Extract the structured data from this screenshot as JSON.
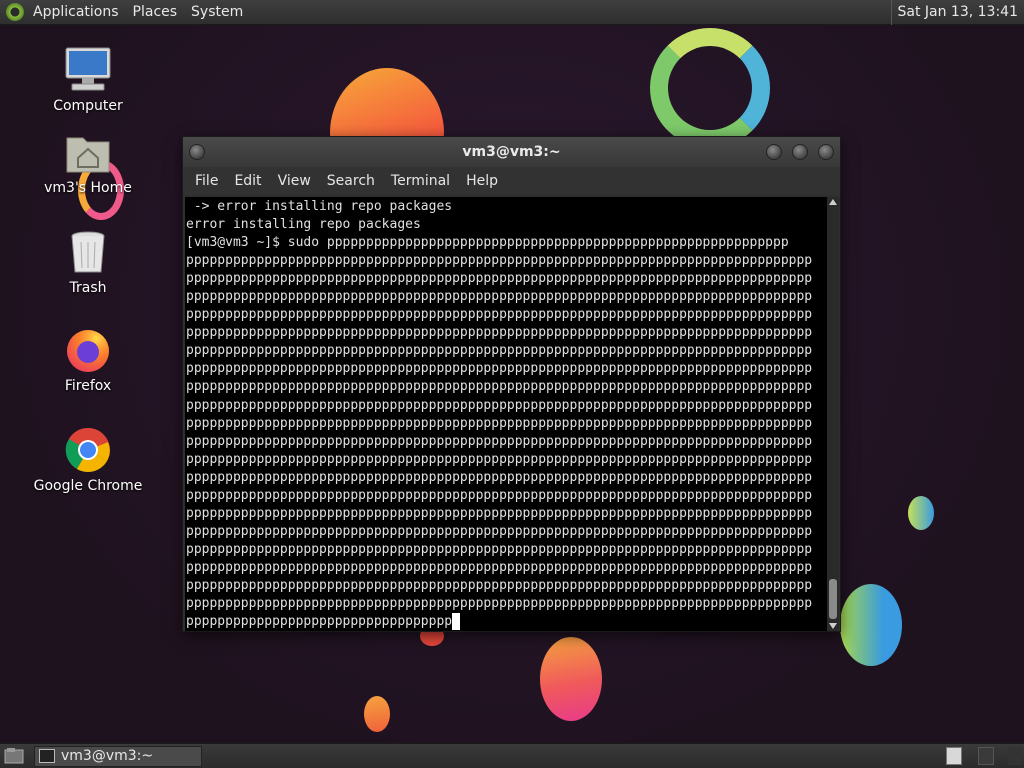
{
  "top_panel": {
    "menus": [
      "Applications",
      "Places",
      "System"
    ],
    "clock": "Sat Jan 13, 13:41"
  },
  "desktop_icons": [
    {
      "label": "Computer",
      "icon": "computer-icon"
    },
    {
      "label": "vm3's Home",
      "icon": "home-folder-icon"
    },
    {
      "label": "Trash",
      "icon": "trash-icon"
    },
    {
      "label": "Firefox",
      "icon": "firefox-icon"
    },
    {
      "label": "Google Chrome",
      "icon": "chrome-icon"
    }
  ],
  "terminal": {
    "title": "vm3@vm3:~",
    "menus": [
      "File",
      "Edit",
      "View",
      "Search",
      "Terminal",
      "Help"
    ],
    "lines": [
      " -> error installing repo packages",
      "error installing repo packages",
      "[vm3@vm3 ~]$ sudo ppppppppppppppppppppppppppppppppppppppppppppppppppppppppppp",
      "pppppppppppppppppppppppppppppppppppppppppppppppppppppppppppppppppppppppppppppppp",
      "pppppppppppppppppppppppppppppppppppppppppppppppppppppppppppppppppppppppppppppppp",
      "pppppppppppppppppppppppppppppppppppppppppppppppppppppppppppppppppppppppppppppppp",
      "pppppppppppppppppppppppppppppppppppppppppppppppppppppppppppppppppppppppppppppppp",
      "pppppppppppppppppppppppppppppppppppppppppppppppppppppppppppppppppppppppppppppppp",
      "pppppppppppppppppppppppppppppppppppppppppppppppppppppppppppppppppppppppppppppppp",
      "pppppppppppppppppppppppppppppppppppppppppppppppppppppppppppppppppppppppppppppppp",
      "pppppppppppppppppppppppppppppppppppppppppppppppppppppppppppppppppppppppppppppppp",
      "pppppppppppppppppppppppppppppppppppppppppppppppppppppppppppppppppppppppppppppppp",
      "pppppppppppppppppppppppppppppppppppppppppppppppppppppppppppppppppppppppppppppppp",
      "pppppppppppppppppppppppppppppppppppppppppppppppppppppppppppppppppppppppppppppppp",
      "pppppppppppppppppppppppppppppppppppppppppppppppppppppppppppppppppppppppppppppppp",
      "pppppppppppppppppppppppppppppppppppppppppppppppppppppppppppppppppppppppppppppppp",
      "pppppppppppppppppppppppppppppppppppppppppppppppppppppppppppppppppppppppppppppppp",
      "pppppppppppppppppppppppppppppppppppppppppppppppppppppppppppppppppppppppppppppppp",
      "pppppppppppppppppppppppppppppppppppppppppppppppppppppppppppppppppppppppppppppppp",
      "pppppppppppppppppppppppppppppppppppppppppppppppppppppppppppppppppppppppppppppppp",
      "pppppppppppppppppppppppppppppppppppppppppppppppppppppppppppppppppppppppppppppppp",
      "pppppppppppppppppppppppppppppppppppppppppppppppppppppppppppppppppppppppppppppppp",
      "pppppppppppppppppppppppppppppppppppppppppppppppppppppppppppppppppppppppppppppppp"
    ],
    "last_line": "pppppppppppppppppppppppppppppppppp"
  },
  "bottom_panel": {
    "task_label": "vm3@vm3:~"
  },
  "colors": {
    "desktop_bg": "#251525",
    "terminal_bg": "#000000",
    "terminal_fg": "#e0e0e0",
    "panel_bg": "#333333"
  }
}
